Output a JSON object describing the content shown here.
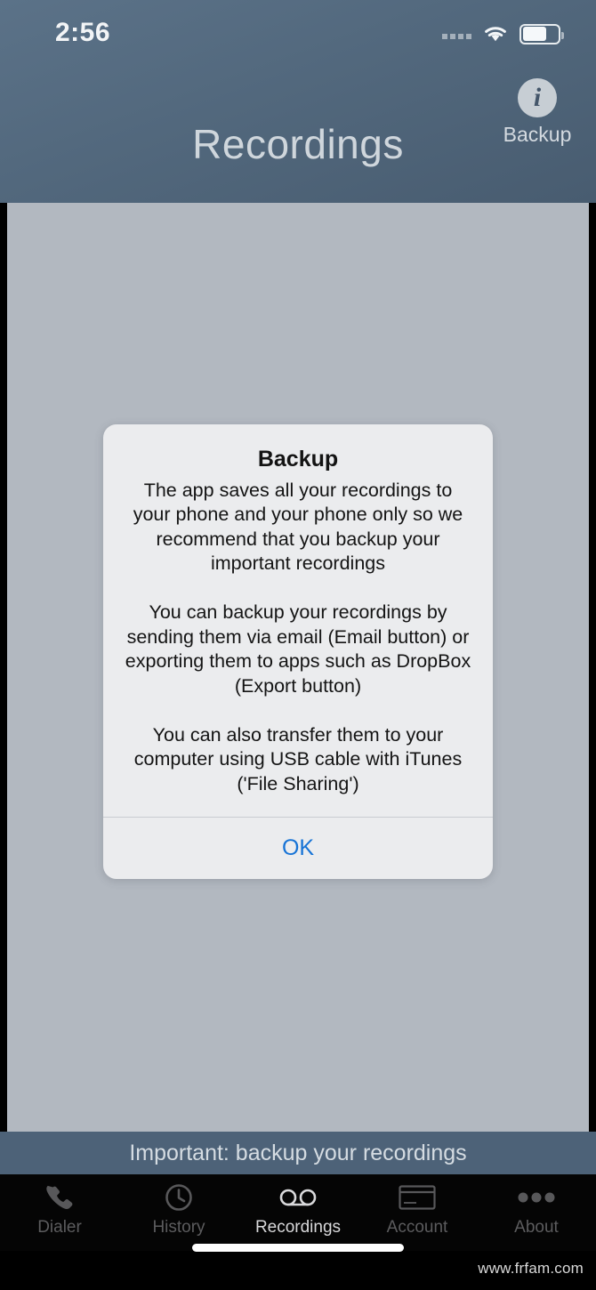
{
  "status_bar": {
    "time": "2:56",
    "signal_icon": "signal-dots-icon",
    "wifi_icon": "wifi-icon",
    "battery_icon": "battery-icon",
    "battery_level_percent": 62
  },
  "nav_bar": {
    "title": "Recordings",
    "right_action": {
      "label": "Backup",
      "icon": "info-circle-icon"
    }
  },
  "dialog": {
    "title": "Backup",
    "message": "The app saves all your recordings to your phone and your phone only so we recommend that you backup your important recordings\n\nYou can backup your recordings by sending them via email (Email button) or exporting them to apps such as DropBox (Export button)\n\nYou can also transfer them to your computer using USB cable with iTunes ('File Sharing')",
    "ok_label": "OK",
    "ok_color": "#1673d6"
  },
  "banner": {
    "text": "Important: backup your recordings",
    "background": "#4d6278"
  },
  "tab_bar": {
    "items": [
      {
        "label": "Dialer",
        "icon": "phone-icon",
        "active": false
      },
      {
        "label": "History",
        "icon": "clock-icon",
        "active": false
      },
      {
        "label": "Recordings",
        "icon": "voicemail-icon",
        "active": true
      },
      {
        "label": "Account",
        "icon": "credit-card-icon",
        "active": false
      },
      {
        "label": "About",
        "icon": "ellipsis-icon",
        "active": false
      }
    ]
  },
  "watermark": "www.frfam.com"
}
